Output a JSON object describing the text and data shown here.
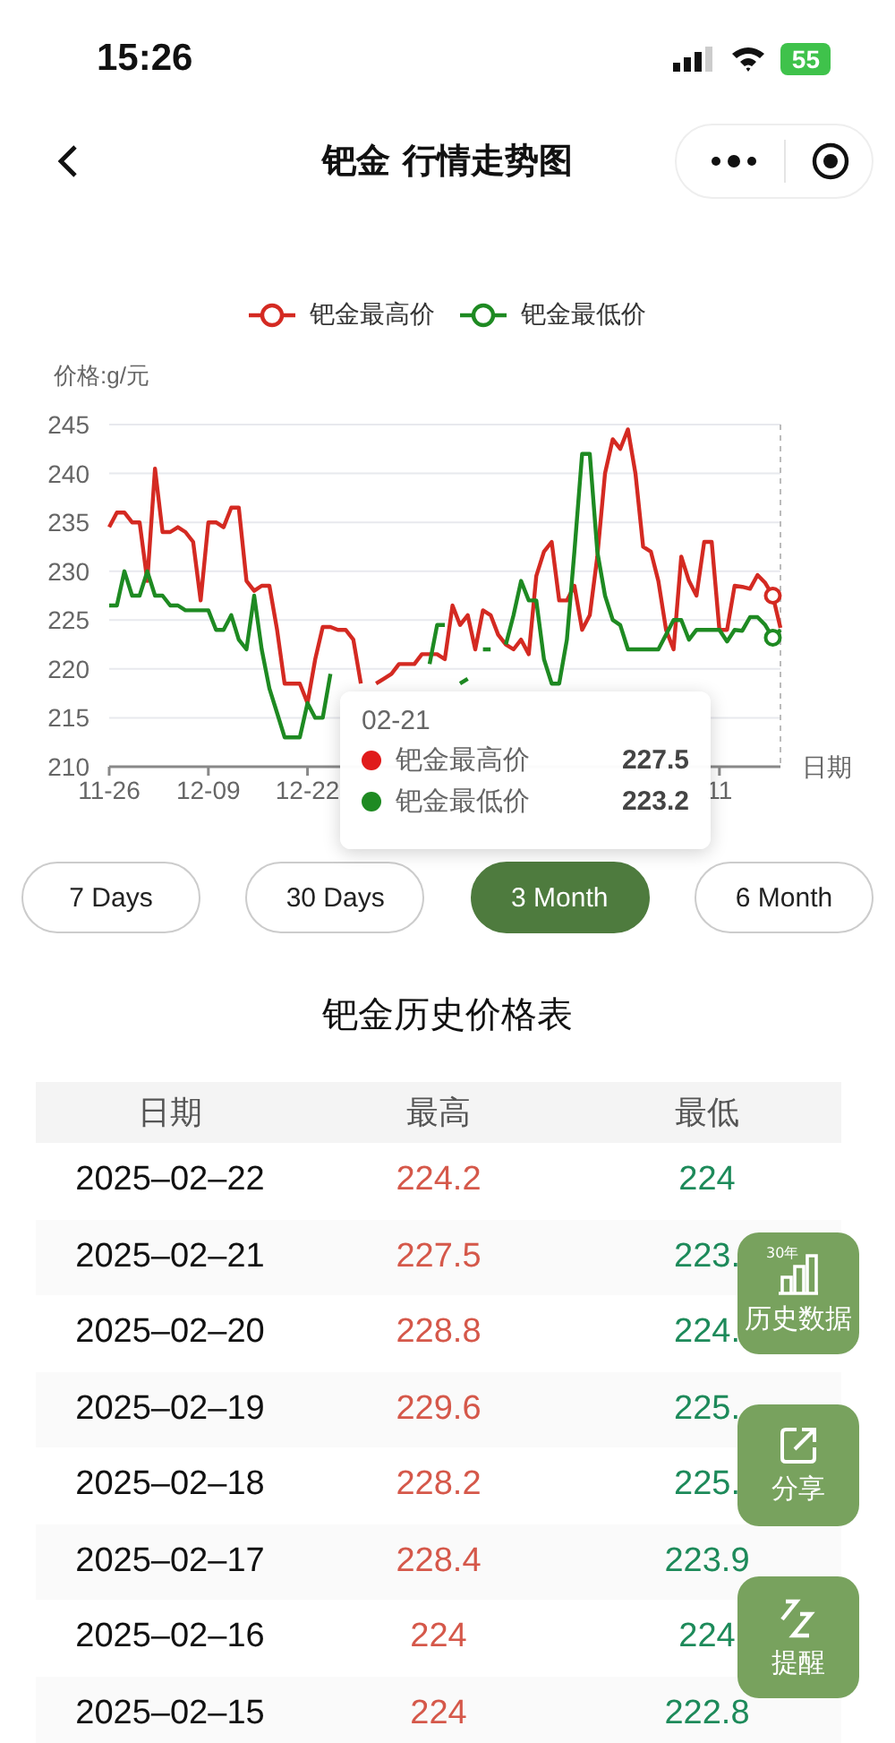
{
  "status_bar": {
    "time": "15:26",
    "battery": "55"
  },
  "nav": {
    "title": "钯金 行情走势图"
  },
  "chart": {
    "chart_data": {
      "type": "line",
      "ylabel": "价格:g/元",
      "xlabel": "日期",
      "grid": true,
      "categories": [
        "11-26",
        null,
        null,
        null,
        null,
        null,
        null,
        null,
        null,
        null,
        null,
        null,
        null,
        "12-09",
        null,
        null,
        null,
        null,
        null,
        null,
        null,
        null,
        null,
        null,
        null,
        null,
        "12-22",
        null,
        null,
        null,
        null,
        null,
        null,
        null,
        null,
        null,
        null,
        null,
        null,
        null,
        null,
        null,
        null,
        null,
        null,
        null,
        null,
        null,
        null,
        null,
        null,
        null,
        null,
        null,
        null,
        null,
        null,
        null,
        null,
        null,
        null,
        null,
        null,
        null,
        null,
        null,
        null,
        null,
        null,
        null,
        null,
        null,
        null,
        null,
        null,
        null,
        null,
        null,
        null,
        null,
        "11",
        null,
        null,
        null,
        null,
        null,
        null,
        null,
        null
      ],
      "series": [
        {
          "name": "钯金最高价",
          "color": "#d42a22",
          "values": [
            234.5,
            236,
            236,
            235,
            235,
            229,
            240.5,
            234,
            234,
            234.5,
            234,
            233,
            227,
            235,
            235,
            234.5,
            236.5,
            236.5,
            229,
            228,
            228.5,
            228.5,
            224,
            218.5,
            218.5,
            218.5,
            216.5,
            221,
            224.3,
            224.3,
            224,
            224,
            223,
            218.5,
            null,
            218.5,
            219,
            219.5,
            220.5,
            220.5,
            220.5,
            221.5,
            221.5,
            221.5,
            221,
            226.5,
            224.5,
            225.5,
            222,
            226,
            225.5,
            223.5,
            222.5,
            222,
            223,
            221.5,
            229.5,
            232,
            233,
            227,
            227,
            228.5,
            224,
            225.5,
            231.5,
            240,
            243.5,
            242.5,
            244.5,
            240,
            232.5,
            232,
            229,
            224,
            222,
            231.5,
            229,
            227.5,
            233,
            233,
            224,
            224,
            228.5,
            228.4,
            228.2,
            229.6,
            228.8,
            227.5,
            224.2
          ]
        },
        {
          "name": "钯金最低价",
          "color": "#1e8a22",
          "values": [
            226.5,
            226.5,
            230,
            227.5,
            227.5,
            230,
            227.5,
            227.5,
            226.5,
            226.5,
            226,
            226,
            226,
            226,
            224,
            224,
            225.5,
            223,
            222,
            227.5,
            222,
            218,
            215.5,
            213,
            213,
            213,
            216.5,
            215,
            215,
            219.5,
            null,
            null,
            null,
            null,
            null,
            null,
            null,
            null,
            null,
            null,
            null,
            null,
            220.5,
            224.5,
            224.5,
            null,
            218.5,
            219,
            null,
            222,
            222,
            null,
            222.5,
            225.5,
            229,
            227,
            227,
            221,
            218.5,
            218.5,
            223,
            232,
            242,
            242,
            232,
            227.5,
            225,
            224.5,
            222,
            222,
            222,
            222,
            222,
            223.5,
            225,
            225,
            223,
            224,
            224,
            224,
            224,
            222.8,
            224,
            223.9,
            225.3,
            225.3,
            224.5,
            223.2,
            224
          ]
        }
      ],
      "ylim": [
        210,
        245
      ],
      "yticks": [
        210,
        215,
        220,
        225,
        230,
        235,
        240,
        245
      ]
    },
    "tooltip": {
      "date": "02-21",
      "rows": [
        {
          "name": "钯金最高价",
          "value": "227.5",
          "color": "#e01b1b"
        },
        {
          "name": "钯金最低价",
          "value": "223.2",
          "color": "#1e8a22"
        }
      ]
    }
  },
  "ranges": [
    {
      "label": "7 Days",
      "selected": false
    },
    {
      "label": "30 Days",
      "selected": false
    },
    {
      "label": "3 Month",
      "selected": true
    },
    {
      "label": "6 Month",
      "selected": false
    }
  ],
  "table": {
    "title": "钯金历史价格表",
    "columns": [
      "日期",
      "最高",
      "最低"
    ],
    "rows": [
      [
        "2025–02–22",
        "224.2",
        "224"
      ],
      [
        "2025–02–21",
        "227.5",
        "223."
      ],
      [
        "2025–02–20",
        "228.8",
        "224."
      ],
      [
        "2025–02–19",
        "229.6",
        "225."
      ],
      [
        "2025–02–18",
        "228.2",
        "225."
      ],
      [
        "2025–02–17",
        "228.4",
        "223.9"
      ],
      [
        "2025–02–16",
        "224",
        "224"
      ],
      [
        "2025–02–15",
        "224",
        "222.8"
      ]
    ]
  },
  "floating_actions": [
    {
      "kind": "history",
      "badge": "30年",
      "label": "历史数据"
    },
    {
      "kind": "share",
      "label": "分享"
    },
    {
      "kind": "remind",
      "label": "提醒"
    }
  ]
}
